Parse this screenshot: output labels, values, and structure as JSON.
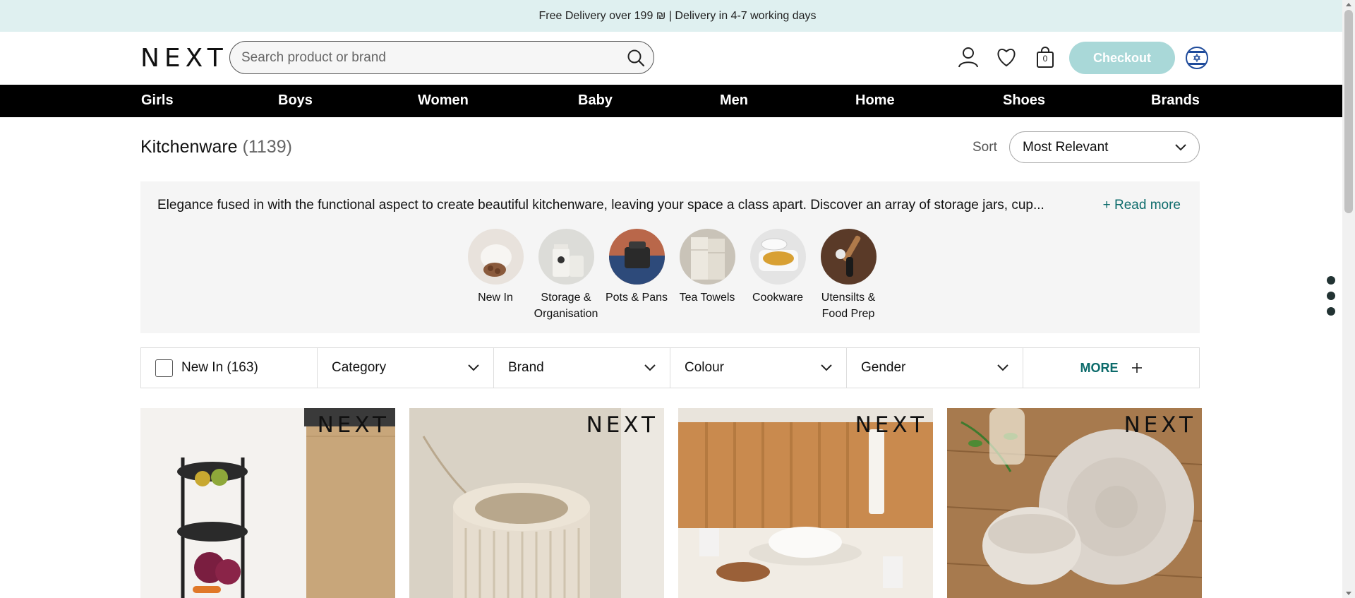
{
  "promo_bar": {
    "text": "Free Delivery over 199 ₪ | Delivery in 4-7 working days"
  },
  "header": {
    "logo": "NEXT",
    "search_placeholder": "Search product or brand",
    "bag_count": "0",
    "checkout_label": "Checkout"
  },
  "nav": {
    "items": [
      "Girls",
      "Boys",
      "Women",
      "Baby",
      "Men",
      "Home",
      "Shoes",
      "Brands"
    ]
  },
  "page": {
    "title": "Kitchenware",
    "count": "(1139)",
    "sort_label": "Sort",
    "sort_value": "Most Relevant"
  },
  "description": {
    "text": "Elegance fused in with the functional aspect to create beautiful kitchenware, leaving your space a class apart. Discover an array of storage jars, cup...",
    "read_more": "+ Read more"
  },
  "categories": [
    {
      "label_line1": "New In",
      "label_line2": ""
    },
    {
      "label_line1": "Storage &",
      "label_line2": "Organisation"
    },
    {
      "label_line1": "Pots & Pans",
      "label_line2": ""
    },
    {
      "label_line1": "Tea Towels",
      "label_line2": ""
    },
    {
      "label_line1": "Cookware",
      "label_line2": ""
    },
    {
      "label_line1": "Utensilts &",
      "label_line2": "Food Prep"
    }
  ],
  "filters": {
    "new_in": "New In (163)",
    "category": "Category",
    "brand": "Brand",
    "colour": "Colour",
    "gender": "Gender",
    "more": "MORE"
  },
  "products": [
    {
      "brand": "NEXT"
    },
    {
      "brand": "NEXT"
    },
    {
      "brand": "NEXT"
    },
    {
      "brand": "NEXT"
    }
  ],
  "colors": {
    "promo_bg": "#dff0f0",
    "nav_bg": "#000000",
    "checkout_bg": "#a9d8d8",
    "accent_teal": "#0c6b6b"
  }
}
